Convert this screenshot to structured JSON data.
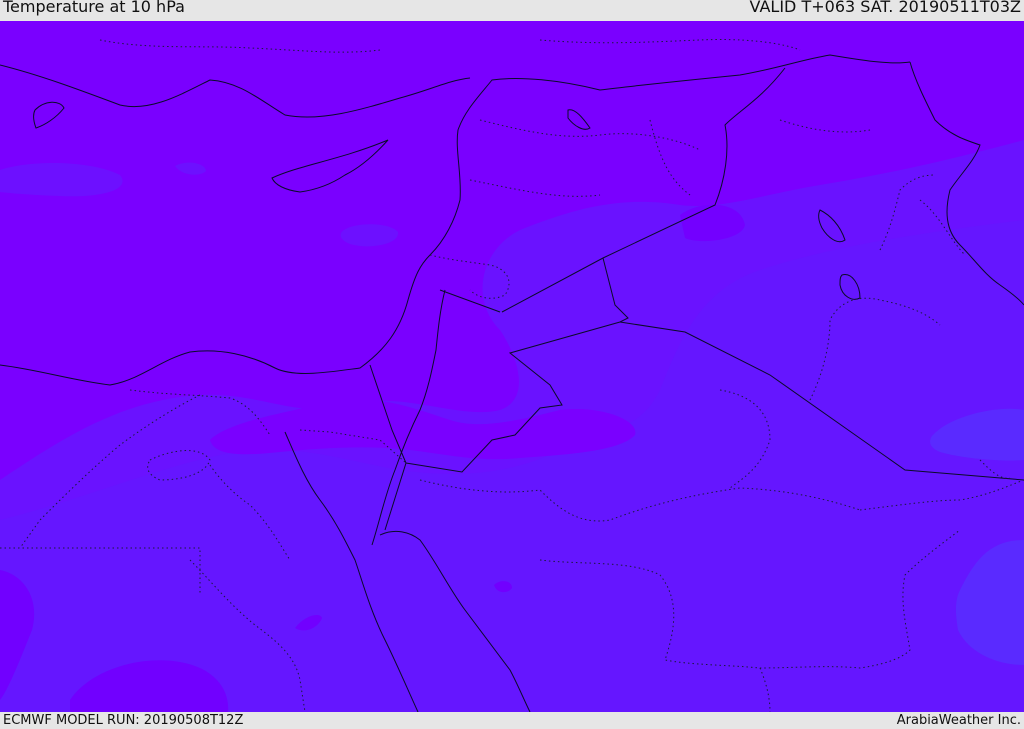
{
  "header": {
    "title": "Temperature at 10 hPa",
    "valid_time": "VALID T+063 SAT. 20190511T03Z"
  },
  "footer": {
    "model_run": "ECMWF MODEL RUN: 20190508T12Z",
    "credit": "ArabiaWeather Inc."
  },
  "map": {
    "variable": "temperature",
    "level": "10 hPa",
    "colors": {
      "warm_violet": "#7a00ff",
      "mid_indigo": "#6a12ff",
      "cool_indigo": "#5f1eff",
      "coolest_blue": "#5a2aff"
    }
  }
}
